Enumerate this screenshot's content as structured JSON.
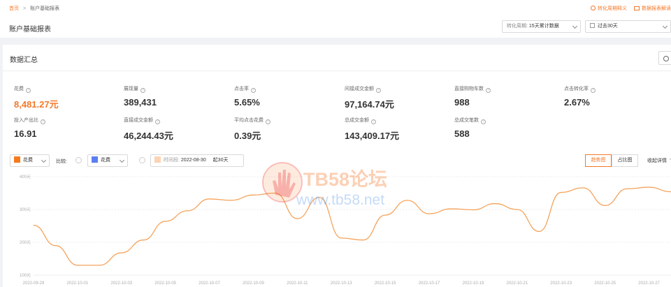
{
  "breadcrumb": {
    "home": "首页",
    "separator": ">",
    "current": "账户基础报表"
  },
  "page_title": "账户基础报表",
  "header_links": {
    "conversion_help": "转化周期释义",
    "data_report": "数据报表解读"
  },
  "filters": {
    "conversion_period": {
      "label": "转化周期:",
      "value": "15天累计数据"
    },
    "date_range": {
      "value": "过去30天"
    }
  },
  "summary": {
    "title": "数据汇总",
    "metrics": [
      {
        "label": "花费",
        "value": "8,481.27元",
        "highlight": true
      },
      {
        "label": "展现量",
        "value": "389,431"
      },
      {
        "label": "点击率",
        "value": "5.65%"
      },
      {
        "label": "间接成交金额",
        "value": "97,164.74元"
      },
      {
        "label": "直接购物车数",
        "value": "988"
      },
      {
        "label": "点击转化率",
        "value": "2.67%"
      },
      {
        "label": "投入产出比",
        "value": "16.91"
      },
      {
        "label": "直接成交金额",
        "value": "46,244.43元"
      },
      {
        "label": "平均点击花费",
        "value": "0.39元"
      },
      {
        "label": "总成交金额",
        "value": "143,409.17元"
      },
      {
        "label": "总成交笔数",
        "value": "588"
      }
    ]
  },
  "chart_controls": {
    "metric_select": {
      "value": "花费",
      "color": "#f57a1f"
    },
    "compare_label": "比较:",
    "compare_select": {
      "value": "花费",
      "color": "#5b7ff0"
    },
    "time_compare": {
      "label": "时间段:",
      "start": "2022-08-30",
      "span": "起30天"
    },
    "view_trend": "趋势图",
    "view_ratio": "占比图",
    "collapse": "收起详情"
  },
  "chart_data": {
    "type": "line",
    "series_color": "#f5a35c",
    "x": [
      "2022-09-29",
      "2022-09-30",
      "2022-10-01",
      "2022-10-02",
      "2022-10-03",
      "2022-10-04",
      "2022-10-05",
      "2022-10-06",
      "2022-10-07",
      "2022-10-08",
      "2022-10-09",
      "2022-10-10",
      "2022-10-11",
      "2022-10-12",
      "2022-10-13",
      "2022-10-14",
      "2022-10-15",
      "2022-10-16",
      "2022-10-17",
      "2022-10-18",
      "2022-10-19",
      "2022-10-20",
      "2022-10-21",
      "2022-10-22",
      "2022-10-23",
      "2022-10-24",
      "2022-10-25",
      "2022-10-26",
      "2022-10-27",
      "2022-10-28"
    ],
    "series": [
      {
        "values": [
          252,
          190,
          130,
          130,
          168,
          207,
          264,
          296,
          332,
          328,
          344,
          350,
          272,
          337,
          213,
          207,
          283,
          328,
          287,
          302,
          299,
          318,
          300,
          233,
          352,
          366,
          312,
          363,
          368,
          354
        ]
      }
    ],
    "x_tick_labels": [
      "2022-09-29",
      "2022-10-01",
      "2022-10-03",
      "2022-10-05",
      "2022-10-07",
      "2022-10-09",
      "2022-10-11",
      "2022-10-13",
      "2022-10-15",
      "2022-10-17",
      "2022-10-19",
      "2022-10-21",
      "2022-10-23",
      "2022-10-25",
      "2022-10-27"
    ],
    "y_ticks": [
      100,
      200,
      300,
      400
    ],
    "y_tick_labels": [
      "100元",
      "200元",
      "300元",
      "400元"
    ],
    "ylim": [
      100,
      400
    ],
    "grid": true
  },
  "watermark": {
    "line1": "TB58论坛",
    "line2": "www.tb58.net"
  }
}
